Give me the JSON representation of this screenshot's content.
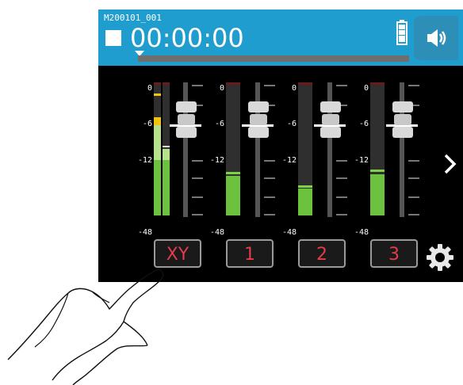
{
  "header": {
    "file_name": "M200101_001",
    "timecode": "00:00:00",
    "progress": 0.0
  },
  "scale": {
    "db_labels": [
      "0",
      "-6",
      "-12",
      "-48"
    ]
  },
  "channels": [
    {
      "label": "XY",
      "level": 0.55
    },
    {
      "label": "1",
      "level": 0.38
    },
    {
      "label": "2",
      "level": 0.31
    },
    {
      "label": "3",
      "level": 0.39
    }
  ],
  "colors": {
    "header_bg": "#1f9dcf",
    "meter_green": "#6cc23f",
    "channel_label": "#e23b4a"
  },
  "icons": {
    "stop": "stop-icon",
    "battery": "battery-icon",
    "speaker": "speaker-icon",
    "next": "chevron-right-icon",
    "settings": "gear-icon",
    "hand": "hand-pointer-icon"
  }
}
